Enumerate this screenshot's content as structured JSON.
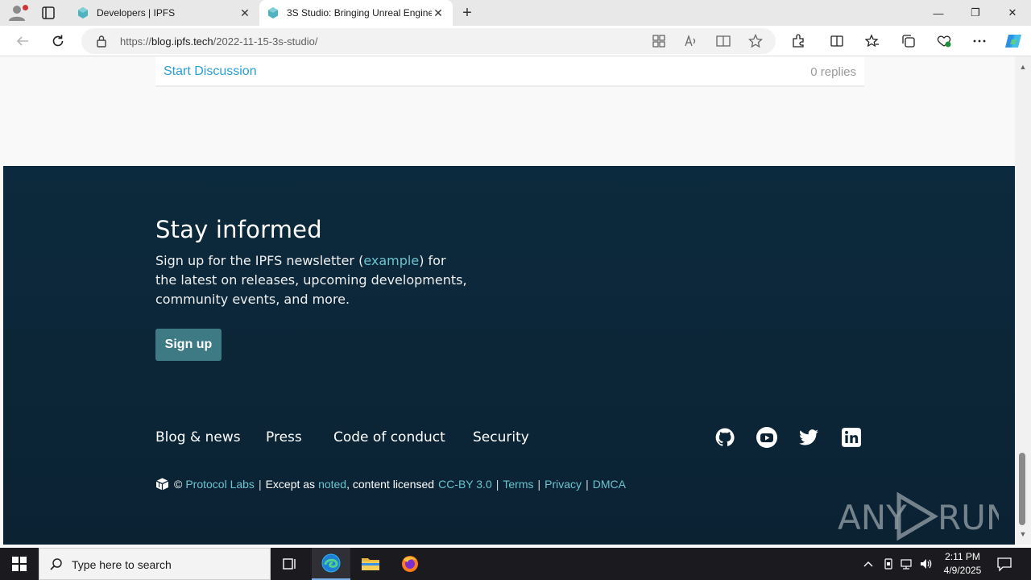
{
  "browser": {
    "tabs": [
      {
        "title": "Developers | IPFS",
        "close": "✕"
      },
      {
        "title": "3S Studio: Bringing Unreal Engine",
        "close": "✕"
      }
    ],
    "new_tab": "+",
    "url_prefix": "https://",
    "url_host": "blog.ipfs.tech",
    "url_path": "/2022-11-15-3s-studio/",
    "window_controls": {
      "minimize": "—",
      "restore": "❐",
      "close": "✕"
    }
  },
  "discussion": {
    "link": "Start Discussion",
    "replies": "0 replies"
  },
  "footer": {
    "stay_title": "Stay informed",
    "stay_text_1": "Sign up for the IPFS newsletter (",
    "stay_link": "example",
    "stay_text_2": ") for the latest on releases, upcoming developments, community events, and more.",
    "signup": "Sign up",
    "nav": [
      "Blog & news",
      "Press",
      "Code of conduct",
      "Security"
    ],
    "social": [
      "github-icon",
      "youtube-icon",
      "twitter-icon",
      "linkedin-icon"
    ],
    "legal": {
      "copyright": "©",
      "protocol_labs": "Protocol Labs",
      "except_as": "Except as",
      "noted": "noted",
      "content_licensed": ", content licensed",
      "license": "CC-BY 3.0",
      "terms": "Terms",
      "privacy": "Privacy",
      "dmca": "DMCA",
      "separator": "|"
    }
  },
  "watermark": "ANY RUN",
  "taskbar": {
    "search_placeholder": "Type here to search",
    "time": "2:11 PM",
    "date": "4/9/2025"
  },
  "colors": {
    "footer_bg": "#0b2233",
    "link_teal": "#69c4cd",
    "signup_bg": "#3e7a84",
    "discussion_link": "#2a9fd6"
  }
}
